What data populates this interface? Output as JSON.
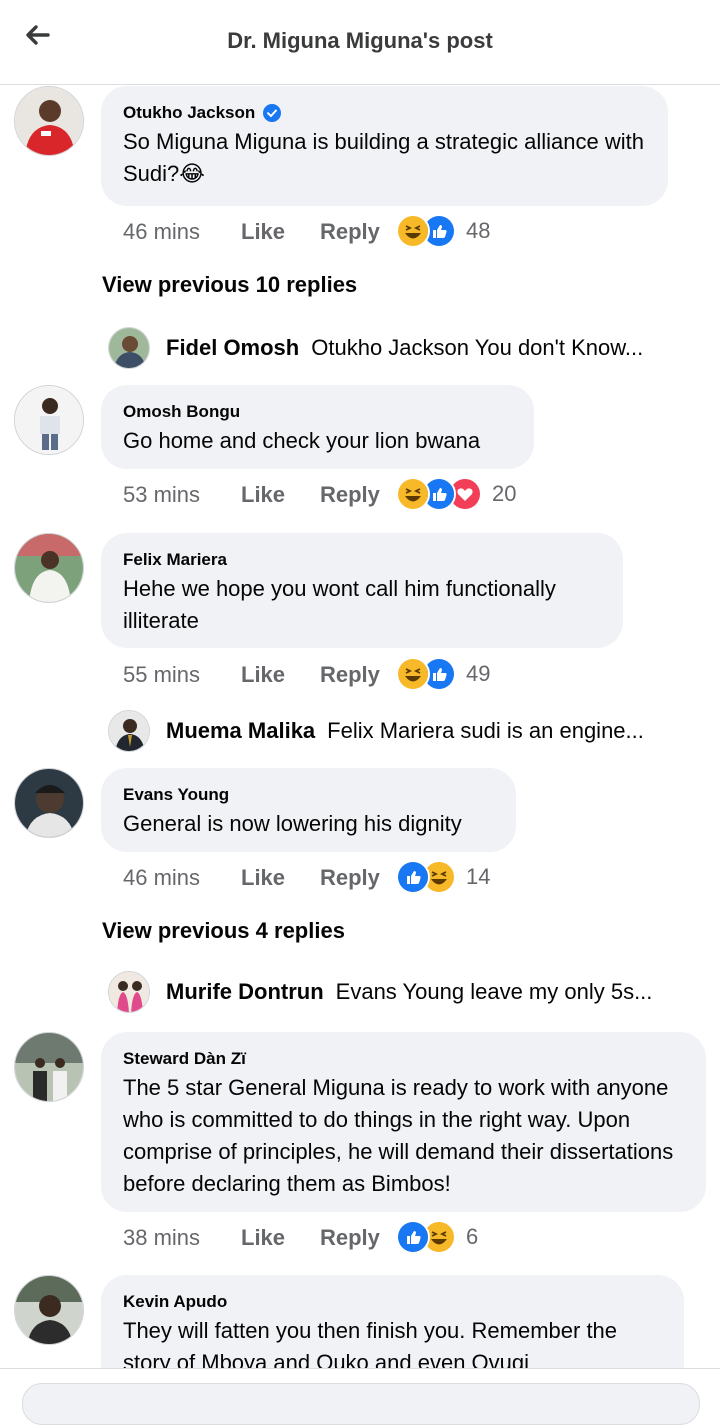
{
  "header": {
    "title": "Dr. Miguna Miguna's post",
    "back_icon": "back-arrow-icon"
  },
  "comments": [
    {
      "author": "Otukho Jackson",
      "verified": true,
      "text": "So Miguna Miguna is building a strategic alliance with Sudi?😂",
      "time": "46 mins",
      "like": "Like",
      "reply": "Reply",
      "reactions": [
        "haha",
        "like"
      ],
      "count": "48"
    },
    {
      "author": "Omosh Bongu",
      "text": "Go home and check your lion bwana",
      "time": "53 mins",
      "like": "Like",
      "reply": "Reply",
      "reactions": [
        "haha",
        "like",
        "love"
      ],
      "count": "20"
    },
    {
      "author": "Felix Mariera",
      "text": "Hehe we hope you wont call him functionally illiterate",
      "time": "55 mins",
      "like": "Like",
      "reply": "Reply",
      "reactions": [
        "haha",
        "like"
      ],
      "count": "49"
    },
    {
      "author": "Evans Young",
      "text": "General is now lowering his dignity",
      "time": "46 mins",
      "like": "Like",
      "reply": "Reply",
      "reactions": [
        "like",
        "haha"
      ],
      "count": "14"
    },
    {
      "author": "Steward Dàn Zï",
      "text": "The 5 star General Miguna is ready to work with anyone who is committed to do things in the right way. Upon comprise of principles, he will demand their dissertations before declaring them as Bimbos!",
      "time": "38 mins",
      "like": "Like",
      "reply": "Reply",
      "reactions": [
        "like",
        "haha"
      ],
      "count": "6"
    },
    {
      "author": "Kevin Apudo",
      "text": "They will fatten you then finish you. Remember the story of Mboya and Ouko and even Ovugi"
    }
  ],
  "view_previous": [
    "View previous 10 replies",
    "View previous 4 replies"
  ],
  "replies": [
    {
      "author": "Fidel Omosh",
      "text": "Otukho Jackson  You don't Know..."
    },
    {
      "author": "Muema Malika",
      "text": "Felix Mariera sudi is an engine..."
    },
    {
      "author": "Murife Dontrun",
      "text": "Evans Young leave my only 5s..."
    }
  ],
  "colors": {
    "like_blue": "#1877f2",
    "haha_yellow": "#f7b928",
    "love_red": "#f33e58",
    "bubble": "#f0f2f5",
    "meta": "#65676b"
  }
}
